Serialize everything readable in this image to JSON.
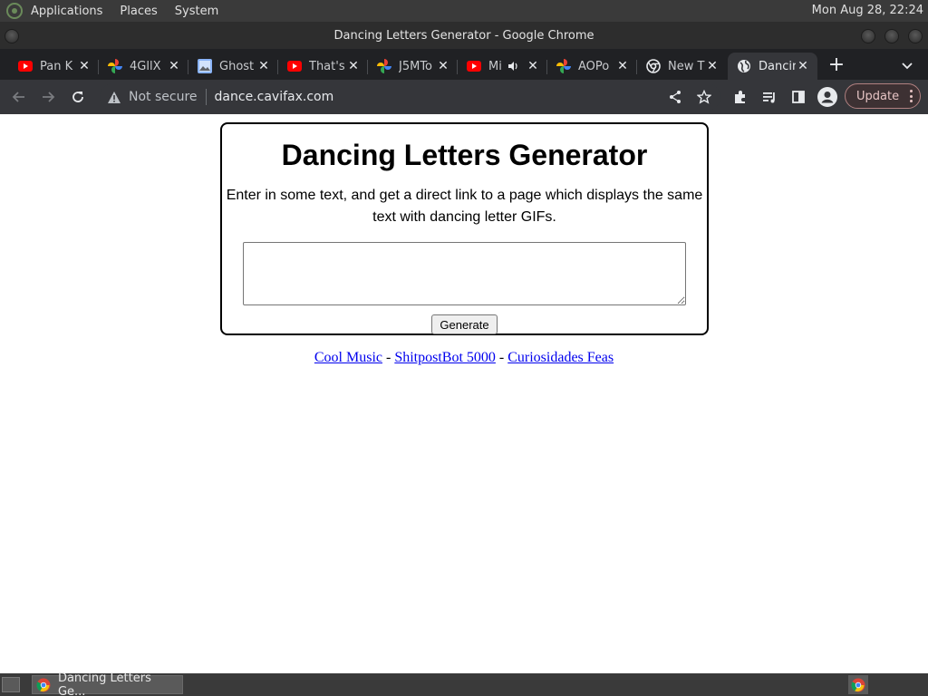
{
  "panel": {
    "menus": [
      "Applications",
      "Places",
      "System"
    ],
    "clock": "Mon Aug 28, 22:24"
  },
  "window": {
    "title": "Dancing Letters Generator - Google Chrome"
  },
  "tabs": [
    {
      "label": "Pan K",
      "icon": "youtube-icon",
      "active": false
    },
    {
      "label": "4GllX",
      "icon": "google-photos-icon",
      "active": false
    },
    {
      "label": "Ghost",
      "icon": "image-icon",
      "active": false
    },
    {
      "label": "That's",
      "icon": "youtube-icon",
      "active": false
    },
    {
      "label": "J5MTo",
      "icon": "google-photos-icon",
      "active": false
    },
    {
      "label": "Mi",
      "icon": "youtube-icon",
      "active": false,
      "audio": true
    },
    {
      "label": "AOPo",
      "icon": "google-photos-icon",
      "active": false
    },
    {
      "label": "New T",
      "icon": "chrome-icon",
      "active": false
    },
    {
      "label": "Dancin",
      "icon": "globe-icon",
      "active": true
    }
  ],
  "toolbar": {
    "security_label": "Not secure",
    "url": "dance.cavifax.com",
    "update_label": "Update"
  },
  "page": {
    "heading": "Dancing Letters Generator",
    "description": "Enter in some text, and get a direct link to a page which displays the same text with dancing letter GIFs.",
    "textarea_value": "",
    "generate_label": "Generate",
    "links": [
      "Cool Music",
      "ShitpostBot 5000",
      "Curiosidades Feas"
    ],
    "separator": "-"
  },
  "taskbar": {
    "window_label": "Dancing Letters Ge..."
  },
  "colors": {
    "link": "#0000ee",
    "tab_active": "#35363a",
    "tabstrip": "#202124"
  }
}
